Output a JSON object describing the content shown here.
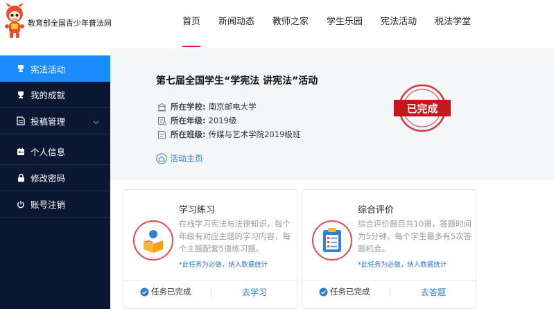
{
  "header": {
    "site_title": "教育部全国青少年普法网",
    "nav": [
      {
        "label": "首页",
        "active": true
      },
      {
        "label": "新闻动态"
      },
      {
        "label": "教师之家"
      },
      {
        "label": "学生乐园"
      },
      {
        "label": "宪法活动"
      },
      {
        "label": "税法学堂"
      }
    ]
  },
  "sidebar": {
    "items": [
      {
        "label": "宪法活动",
        "icon": "trophy-icon",
        "active": true
      },
      {
        "label": "我的成就",
        "icon": "trophy-icon"
      },
      {
        "label": "投稿管理",
        "icon": "document-icon",
        "expandable": true
      },
      {
        "label": "个人信息",
        "icon": "id-card-icon"
      },
      {
        "label": "修改密码",
        "icon": "lock-icon"
      },
      {
        "label": "账号注销",
        "icon": "power-icon"
      }
    ]
  },
  "activity": {
    "title": "第七届全国学生“学宪法 讲宪法”活动",
    "school_label": "所在学校:",
    "school": "南京邮电大学",
    "grade_label": "所在年级:",
    "grade": "2019级",
    "class_label": "所在班级:",
    "class": "传媒与艺术学院2019级班",
    "home_link": "活动主页",
    "stamp_text": "已完成"
  },
  "cards": [
    {
      "title": "学习练习",
      "description": "在线学习宪法与法律知识，每个年级有对应主题的学习内容，每个主题配套5道练习题。",
      "note": "*此任务为必做，纳入数据统计",
      "status": "任务已完成",
      "action": "去学习",
      "icon": "reading-student-icon"
    },
    {
      "title": "综合评价",
      "description": "综合评价题目共10道，答题时间为5分钟，每个学生最多有5次答题机会。",
      "note": "*此任务为必做，纳入数据统计",
      "status": "任务已完成",
      "action": "去答题",
      "icon": "clipboard-icon"
    }
  ],
  "colors": {
    "accent_blue": "#1a8cff",
    "sidebar_bg": "#0b1733",
    "stamp_red": "#c8161d",
    "link_blue": "#2a78d4"
  }
}
